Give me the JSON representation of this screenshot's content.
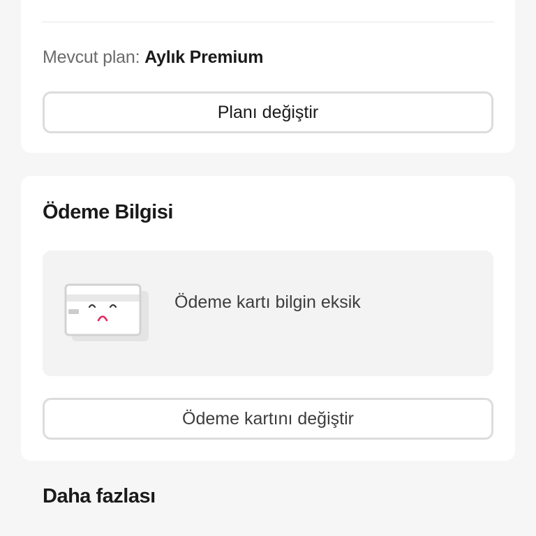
{
  "subscription": {
    "plan_label": "Mevcut plan:",
    "plan_value": "Aylık Premium",
    "change_plan_label": "Planı değiştir"
  },
  "payment": {
    "title": "Ödeme Bilgisi",
    "missing_message": "Ödeme kartı bilgin eksik",
    "change_card_label": "Ödeme kartını değiştir",
    "illustration_icon": "sad-card-icon",
    "face_color": "#e0245e"
  },
  "more": {
    "title": "Daha fazlası"
  }
}
